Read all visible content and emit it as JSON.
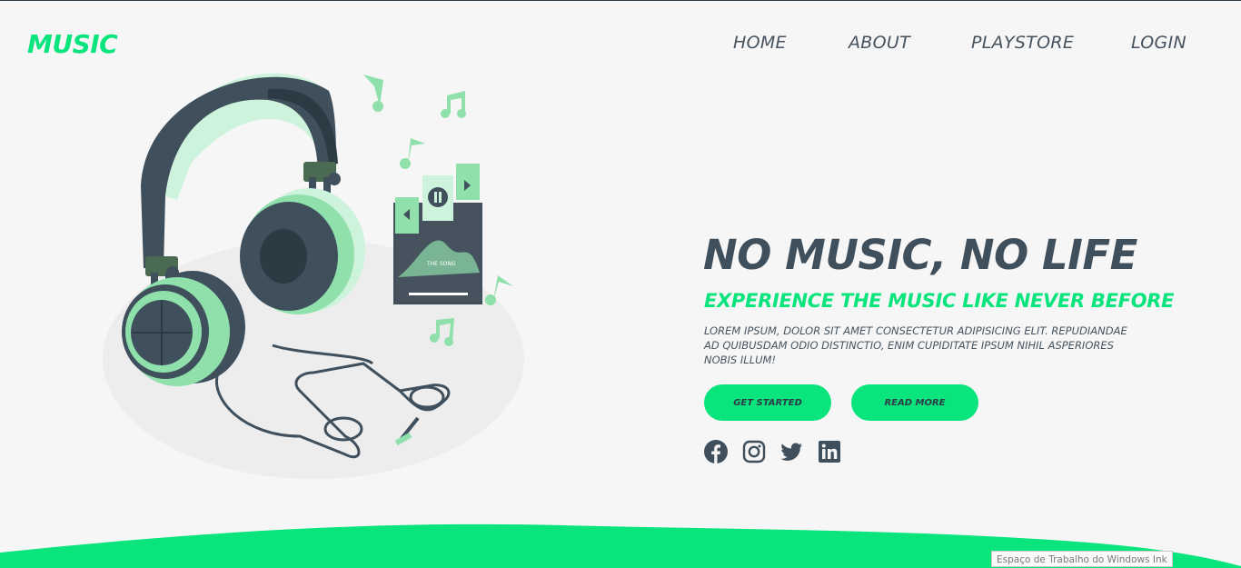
{
  "brand": {
    "logo": "MUSIC",
    "accent": "#0ae47c",
    "dark": "#3f4f5c"
  },
  "nav": {
    "items": [
      "HOME",
      "ABOUT",
      "PLAYSTORE",
      "LOGIN"
    ]
  },
  "hero": {
    "title": "NO MUSIC, NO LIFE",
    "subtitle": "EXPERIENCE THE MUSIC LIKE NEVER BEFORE",
    "text": "LOREM IPSUM, DOLOR SIT AMET CONSECTETUR ADIPISICING ELIT. REPUDIANDAE AD QUIBUSDAM ODIO DISTINCTIO, ENIM CUPIDITATE IPSUM NIHIL ASPERIORES NOBIS ILLUM!",
    "buttons": {
      "start": "GET STARTED",
      "read": "READ MORE"
    }
  },
  "illustration": {
    "screen_label": "THE SONG"
  },
  "social": [
    "facebook-icon",
    "instagram-icon",
    "twitter-icon",
    "linkedin-icon"
  ],
  "tooltip": "Espaço de Trabalho do Windows Ink"
}
